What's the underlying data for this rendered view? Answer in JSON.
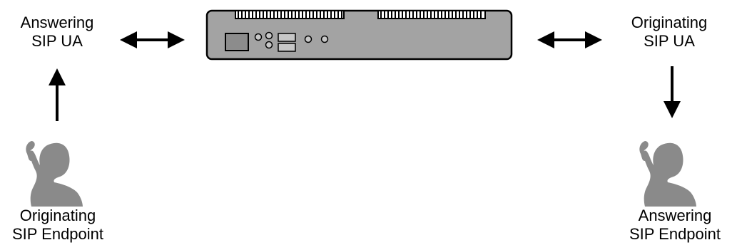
{
  "labels": {
    "answering_ua": {
      "line1": "Answering",
      "line2": "SIP UA"
    },
    "originating_ua": {
      "line1": "Originating",
      "line2": "SIP UA"
    },
    "originating_endpoint": {
      "line1": "Originating",
      "line2": "SIP Endpoint"
    },
    "answering_endpoint": {
      "line1": "Answering",
      "line2": "SIP Endpoint"
    }
  },
  "icons": {
    "device": "sip-appliance-icon",
    "left_person": "person-on-phone-icon",
    "right_person": "person-on-phone-icon"
  },
  "colors": {
    "device_fill": "#a3a3a3",
    "device_stroke": "#000000",
    "person_fill": "#8a8a8a",
    "arrow": "#000000"
  }
}
